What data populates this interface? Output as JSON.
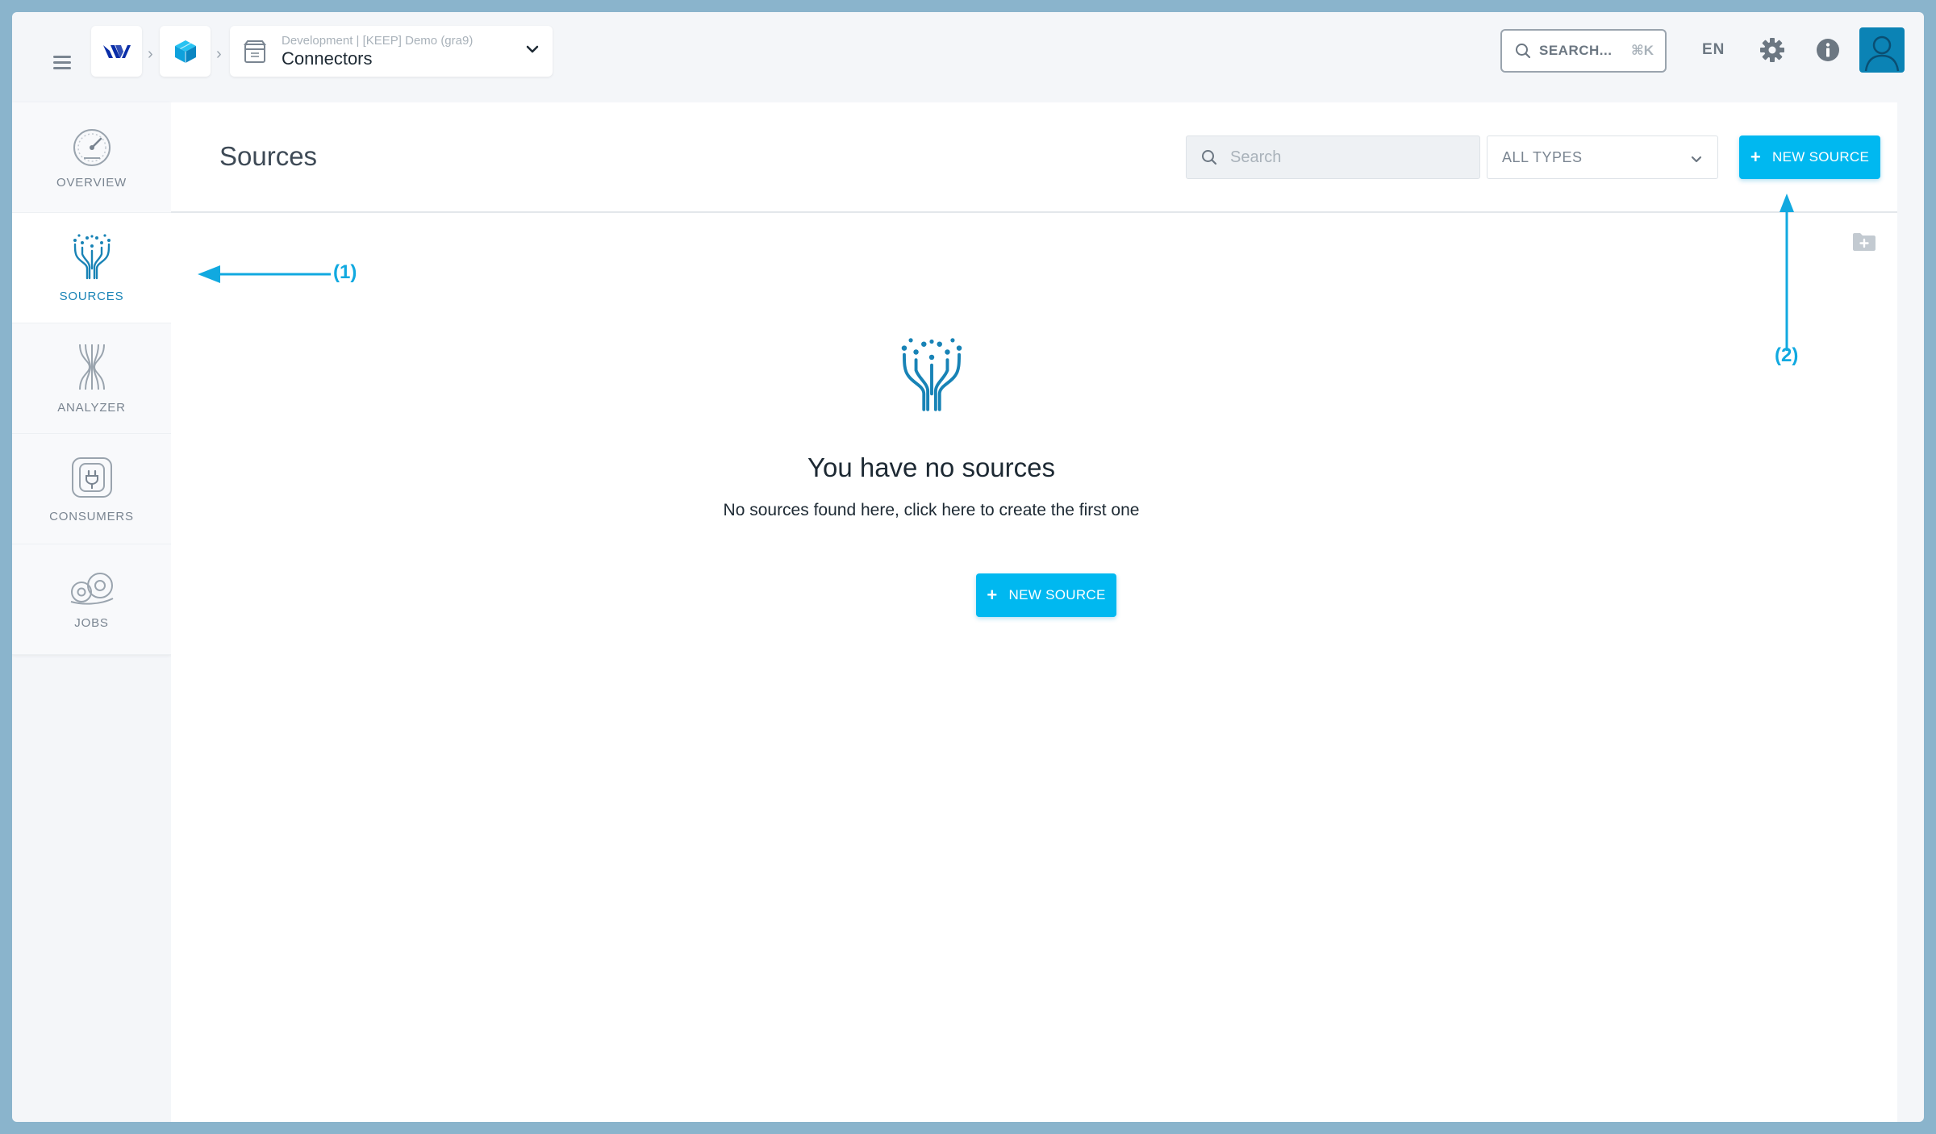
{
  "topbar": {
    "project_subtitle": "Development | [KEEP] Demo (gra9)",
    "project_title": "Connectors",
    "search_label": "SEARCH...",
    "search_shortcut": "⌘K",
    "language": "EN"
  },
  "sidebar": {
    "items": [
      {
        "label": "OVERVIEW",
        "icon": "gauge-icon"
      },
      {
        "label": "SOURCES",
        "icon": "sources-icon",
        "active": true
      },
      {
        "label": "ANALYZER",
        "icon": "analyzer-icon"
      },
      {
        "label": "CONSUMERS",
        "icon": "plug-icon"
      },
      {
        "label": "JOBS",
        "icon": "gears-icon"
      }
    ]
  },
  "main": {
    "title": "Sources",
    "search_placeholder": "Search",
    "type_filter": "ALL TYPES",
    "new_source_label": "NEW SOURCE"
  },
  "empty_state": {
    "title": "You have no sources",
    "description": "No sources found here, click here to create the first one",
    "button_label": "NEW SOURCE"
  },
  "annotations": {
    "one": "(1)",
    "two": "(2)"
  },
  "colors": {
    "accent": "#00b8f0",
    "active_blue": "#1883b6",
    "annotation": "#11a9e0"
  }
}
